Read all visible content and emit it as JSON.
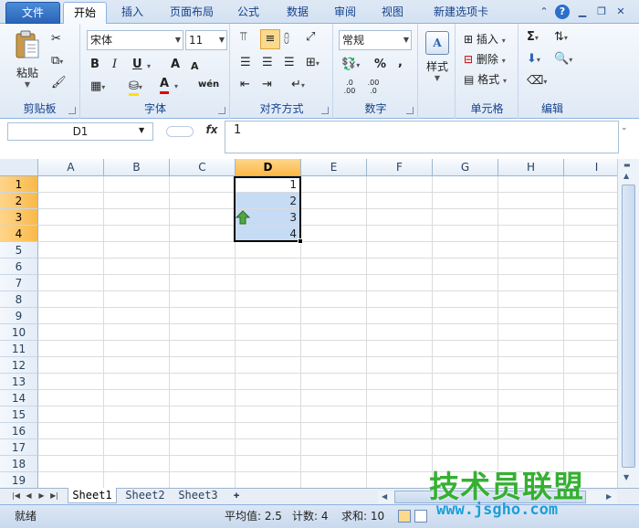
{
  "tabs": {
    "file": "文件",
    "home": "开始",
    "insert": "插入",
    "layout": "页面布局",
    "formulas": "公式",
    "data": "数据",
    "review": "审阅",
    "view": "视图",
    "new_tab": "新建选项卡"
  },
  "clipboard": {
    "paste": "粘贴",
    "label": "剪贴板"
  },
  "font": {
    "name": "宋体",
    "size": "11",
    "label": "字体",
    "bold": "B",
    "italic": "I",
    "underline": "U",
    "grow": "A",
    "shrink": "A",
    "font_color": "A",
    "phonetic": "wén"
  },
  "alignment": {
    "label": "对齐方式"
  },
  "number": {
    "format": "常规",
    "label": "数字",
    "percent": "%",
    "comma": ",",
    "inc_decimal": ".0 .00",
    "dec_decimal": ".00 .0"
  },
  "styles": {
    "label": "样式"
  },
  "cells": {
    "insert": "插入",
    "delete": "删除",
    "format": "格式",
    "label": "单元格"
  },
  "editing": {
    "sum": "Σ",
    "label": "编辑"
  },
  "formula_bar": {
    "name_box": "D1",
    "fx": "fx",
    "content": "1"
  },
  "columns": [
    "A",
    "B",
    "C",
    "D",
    "E",
    "F",
    "G",
    "H",
    "I"
  ],
  "rows": [
    "1",
    "2",
    "3",
    "4",
    "5",
    "6",
    "7",
    "8",
    "9",
    "10",
    "11",
    "12",
    "13",
    "14",
    "15",
    "16",
    "17",
    "18",
    "19"
  ],
  "cells_data": {
    "D1": "1",
    "D2": "2",
    "D3": "3",
    "D4": "4"
  },
  "selected_column": "D",
  "selected_rows": [
    "1",
    "2",
    "3",
    "4"
  ],
  "sheets": [
    "Sheet1",
    "Sheet2",
    "Sheet3"
  ],
  "active_sheet": "Sheet1",
  "status": {
    "ready": "就绪",
    "average": "平均值: 2.5",
    "count": "计数: 4",
    "sum": "求和: 10"
  },
  "watermark": {
    "line1": "技术员联盟",
    "line2": "www.jsgho.com"
  },
  "colors": {
    "accent": "#2a64b8",
    "selection": "#c6dbf4",
    "header_selected": "#f9b949"
  }
}
